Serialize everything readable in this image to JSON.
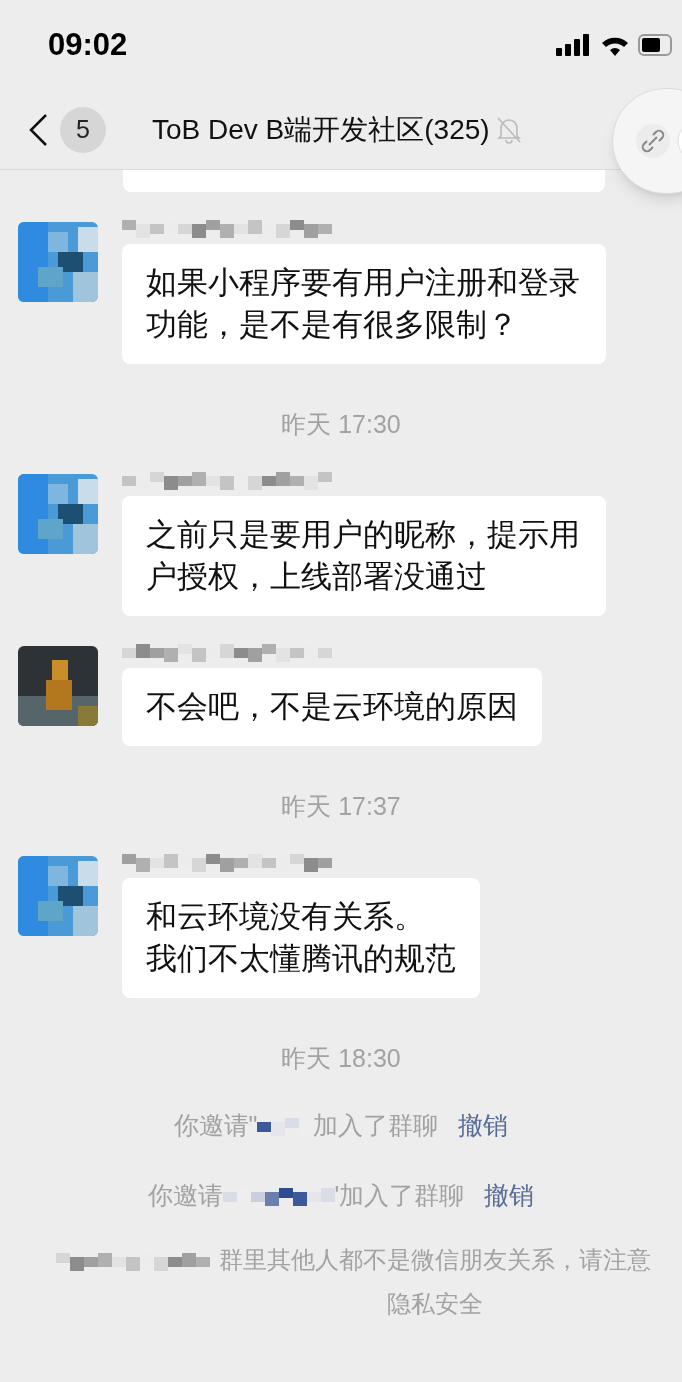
{
  "status_bar": {
    "time": "09:02"
  },
  "nav": {
    "unread_count": "5",
    "title": "ToB Dev B端开发社区(325)",
    "muted": true
  },
  "messages": [
    {
      "kind": "message",
      "lines": [
        "如果小程序要有用户注册和登录功能，是不是有很多限制？"
      ]
    },
    {
      "kind": "time",
      "text": "昨天 17:30"
    },
    {
      "kind": "message",
      "lines": [
        "之前只是要用户的昵称，提示用户授权，上线部署没通过"
      ]
    },
    {
      "kind": "message",
      "lines": [
        "不会吧，不是云环境的原因"
      ]
    },
    {
      "kind": "time",
      "text": "昨天 17:37"
    },
    {
      "kind": "message",
      "lines": [
        "和云环境没有关系。",
        "我们不太懂腾讯的规范"
      ]
    },
    {
      "kind": "time",
      "text": "昨天 18:30"
    },
    {
      "kind": "invite",
      "before": "你邀请\"",
      "after": "加入了群聊",
      "link": "撤销"
    },
    {
      "kind": "invite",
      "before": "你邀请",
      "after": "'加入了群聊",
      "link": "撤销"
    },
    {
      "kind": "notice",
      "text": "群里其他人都不是微信朋友关系，请注意隐私安全"
    }
  ]
}
